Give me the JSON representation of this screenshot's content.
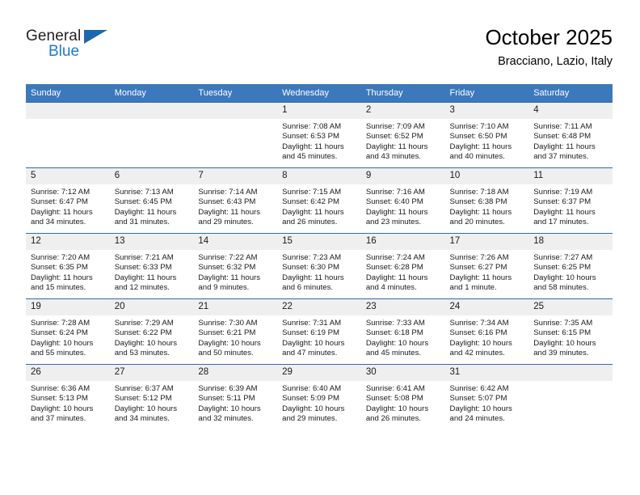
{
  "brand": {
    "name_top": "General",
    "name_bottom": "Blue",
    "accent_color": "#1b68ad",
    "text_color": "#231f20",
    "blue_text_color": "#1c7cc4"
  },
  "header": {
    "title": "October 2025",
    "subtitle": "Bracciano, Lazio, Italy"
  },
  "theme": {
    "header_bg": "#3c78bc",
    "row_border": "#2e6cab",
    "daynum_bg": "#efefef",
    "page_bg": "#ffffff"
  },
  "calendar": {
    "weekday_headers": [
      "Sunday",
      "Monday",
      "Tuesday",
      "Wednesday",
      "Thursday",
      "Friday",
      "Saturday"
    ],
    "weeks": [
      [
        {
          "day": "",
          "sunrise": "",
          "sunset": "",
          "daylight": "",
          "empty": true
        },
        {
          "day": "",
          "sunrise": "",
          "sunset": "",
          "daylight": "",
          "empty": true
        },
        {
          "day": "",
          "sunrise": "",
          "sunset": "",
          "daylight": "",
          "empty": true
        },
        {
          "day": "1",
          "sunrise": "Sunrise: 7:08 AM",
          "sunset": "Sunset: 6:53 PM",
          "daylight": "Daylight: 11 hours and 45 minutes.",
          "empty": false
        },
        {
          "day": "2",
          "sunrise": "Sunrise: 7:09 AM",
          "sunset": "Sunset: 6:52 PM",
          "daylight": "Daylight: 11 hours and 43 minutes.",
          "empty": false
        },
        {
          "day": "3",
          "sunrise": "Sunrise: 7:10 AM",
          "sunset": "Sunset: 6:50 PM",
          "daylight": "Daylight: 11 hours and 40 minutes.",
          "empty": false
        },
        {
          "day": "4",
          "sunrise": "Sunrise: 7:11 AM",
          "sunset": "Sunset: 6:48 PM",
          "daylight": "Daylight: 11 hours and 37 minutes.",
          "empty": false
        }
      ],
      [
        {
          "day": "5",
          "sunrise": "Sunrise: 7:12 AM",
          "sunset": "Sunset: 6:47 PM",
          "daylight": "Daylight: 11 hours and 34 minutes.",
          "empty": false
        },
        {
          "day": "6",
          "sunrise": "Sunrise: 7:13 AM",
          "sunset": "Sunset: 6:45 PM",
          "daylight": "Daylight: 11 hours and 31 minutes.",
          "empty": false
        },
        {
          "day": "7",
          "sunrise": "Sunrise: 7:14 AM",
          "sunset": "Sunset: 6:43 PM",
          "daylight": "Daylight: 11 hours and 29 minutes.",
          "empty": false
        },
        {
          "day": "8",
          "sunrise": "Sunrise: 7:15 AM",
          "sunset": "Sunset: 6:42 PM",
          "daylight": "Daylight: 11 hours and 26 minutes.",
          "empty": false
        },
        {
          "day": "9",
          "sunrise": "Sunrise: 7:16 AM",
          "sunset": "Sunset: 6:40 PM",
          "daylight": "Daylight: 11 hours and 23 minutes.",
          "empty": false
        },
        {
          "day": "10",
          "sunrise": "Sunrise: 7:18 AM",
          "sunset": "Sunset: 6:38 PM",
          "daylight": "Daylight: 11 hours and 20 minutes.",
          "empty": false
        },
        {
          "day": "11",
          "sunrise": "Sunrise: 7:19 AM",
          "sunset": "Sunset: 6:37 PM",
          "daylight": "Daylight: 11 hours and 17 minutes.",
          "empty": false
        }
      ],
      [
        {
          "day": "12",
          "sunrise": "Sunrise: 7:20 AM",
          "sunset": "Sunset: 6:35 PM",
          "daylight": "Daylight: 11 hours and 15 minutes.",
          "empty": false
        },
        {
          "day": "13",
          "sunrise": "Sunrise: 7:21 AM",
          "sunset": "Sunset: 6:33 PM",
          "daylight": "Daylight: 11 hours and 12 minutes.",
          "empty": false
        },
        {
          "day": "14",
          "sunrise": "Sunrise: 7:22 AM",
          "sunset": "Sunset: 6:32 PM",
          "daylight": "Daylight: 11 hours and 9 minutes.",
          "empty": false
        },
        {
          "day": "15",
          "sunrise": "Sunrise: 7:23 AM",
          "sunset": "Sunset: 6:30 PM",
          "daylight": "Daylight: 11 hours and 6 minutes.",
          "empty": false
        },
        {
          "day": "16",
          "sunrise": "Sunrise: 7:24 AM",
          "sunset": "Sunset: 6:28 PM",
          "daylight": "Daylight: 11 hours and 4 minutes.",
          "empty": false
        },
        {
          "day": "17",
          "sunrise": "Sunrise: 7:26 AM",
          "sunset": "Sunset: 6:27 PM",
          "daylight": "Daylight: 11 hours and 1 minute.",
          "empty": false
        },
        {
          "day": "18",
          "sunrise": "Sunrise: 7:27 AM",
          "sunset": "Sunset: 6:25 PM",
          "daylight": "Daylight: 10 hours and 58 minutes.",
          "empty": false
        }
      ],
      [
        {
          "day": "19",
          "sunrise": "Sunrise: 7:28 AM",
          "sunset": "Sunset: 6:24 PM",
          "daylight": "Daylight: 10 hours and 55 minutes.",
          "empty": false
        },
        {
          "day": "20",
          "sunrise": "Sunrise: 7:29 AM",
          "sunset": "Sunset: 6:22 PM",
          "daylight": "Daylight: 10 hours and 53 minutes.",
          "empty": false
        },
        {
          "day": "21",
          "sunrise": "Sunrise: 7:30 AM",
          "sunset": "Sunset: 6:21 PM",
          "daylight": "Daylight: 10 hours and 50 minutes.",
          "empty": false
        },
        {
          "day": "22",
          "sunrise": "Sunrise: 7:31 AM",
          "sunset": "Sunset: 6:19 PM",
          "daylight": "Daylight: 10 hours and 47 minutes.",
          "empty": false
        },
        {
          "day": "23",
          "sunrise": "Sunrise: 7:33 AM",
          "sunset": "Sunset: 6:18 PM",
          "daylight": "Daylight: 10 hours and 45 minutes.",
          "empty": false
        },
        {
          "day": "24",
          "sunrise": "Sunrise: 7:34 AM",
          "sunset": "Sunset: 6:16 PM",
          "daylight": "Daylight: 10 hours and 42 minutes.",
          "empty": false
        },
        {
          "day": "25",
          "sunrise": "Sunrise: 7:35 AM",
          "sunset": "Sunset: 6:15 PM",
          "daylight": "Daylight: 10 hours and 39 minutes.",
          "empty": false
        }
      ],
      [
        {
          "day": "26",
          "sunrise": "Sunrise: 6:36 AM",
          "sunset": "Sunset: 5:13 PM",
          "daylight": "Daylight: 10 hours and 37 minutes.",
          "empty": false
        },
        {
          "day": "27",
          "sunrise": "Sunrise: 6:37 AM",
          "sunset": "Sunset: 5:12 PM",
          "daylight": "Daylight: 10 hours and 34 minutes.",
          "empty": false
        },
        {
          "day": "28",
          "sunrise": "Sunrise: 6:39 AM",
          "sunset": "Sunset: 5:11 PM",
          "daylight": "Daylight: 10 hours and 32 minutes.",
          "empty": false
        },
        {
          "day": "29",
          "sunrise": "Sunrise: 6:40 AM",
          "sunset": "Sunset: 5:09 PM",
          "daylight": "Daylight: 10 hours and 29 minutes.",
          "empty": false
        },
        {
          "day": "30",
          "sunrise": "Sunrise: 6:41 AM",
          "sunset": "Sunset: 5:08 PM",
          "daylight": "Daylight: 10 hours and 26 minutes.",
          "empty": false
        },
        {
          "day": "31",
          "sunrise": "Sunrise: 6:42 AM",
          "sunset": "Sunset: 5:07 PM",
          "daylight": "Daylight: 10 hours and 24 minutes.",
          "empty": false
        },
        {
          "day": "",
          "sunrise": "",
          "sunset": "",
          "daylight": "",
          "empty": true
        }
      ]
    ]
  }
}
